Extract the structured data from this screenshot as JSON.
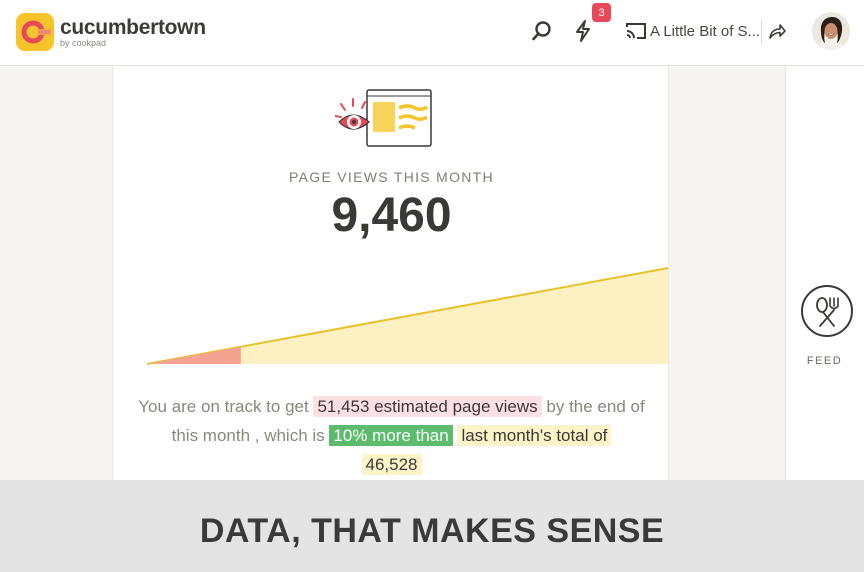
{
  "header": {
    "logo_text": "cucumbertown",
    "logo_sub": "by cookpad",
    "notification_count": "3",
    "recipe_title": "A Little Bit of S...",
    "icons": [
      "search-icon",
      "lightning-icon",
      "cast-icon",
      "share-icon"
    ]
  },
  "stats": {
    "label": "PAGE VIEWS THIS MONTH",
    "count": "9,460",
    "progress_fraction": 0.18
  },
  "summary": {
    "t1": "You are on track to get",
    "estimate": "51,453 estimated page views",
    "t2": "by the end of this month , which is",
    "growth": "10% more than",
    "last_month": "last month's total of",
    "total": "46,528"
  },
  "sidebar": {
    "feed_label": "FEED"
  },
  "banner": {
    "tagline": "DATA, THAT MAKES SENSE"
  },
  "colors": {
    "accent_yellow": "#f5c42b",
    "logo_red": "#e8485a",
    "trend_line": "#e8c22a",
    "trend_fill": "#fdf0c2",
    "progress_fill": "#f4a391",
    "growth_green": "#5dbb6e",
    "estimate_pink": "#fde0e4"
  }
}
